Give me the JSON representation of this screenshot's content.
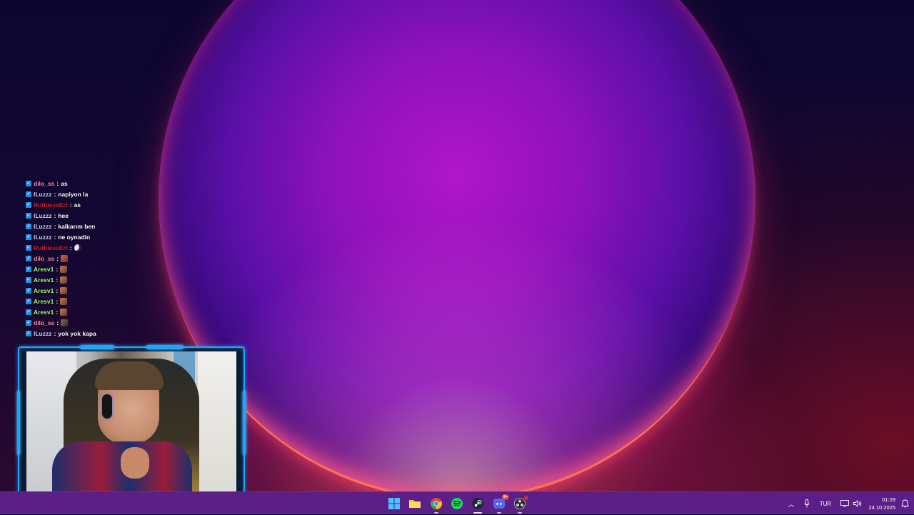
{
  "chat": {
    "messages": [
      {
        "user": "dilo_ss",
        "user_color": "#ff8fb0",
        "text": "as",
        "emote": null
      },
      {
        "user": "lLuzzz",
        "user_color": "#c9d6ff",
        "text": "napiyon la",
        "emote": null
      },
      {
        "user": "RuthlessErt",
        "user_color": "#d4202a",
        "text": "as",
        "emote": null
      },
      {
        "user": "lLuzzz",
        "user_color": "#c9d6ff",
        "text": "hee",
        "emote": null
      },
      {
        "user": "lLuzzz",
        "user_color": "#c9d6ff",
        "text": "kalkarım ben",
        "emote": null
      },
      {
        "user": "lLuzzz",
        "user_color": "#c9d6ff",
        "text": "ne oynadin",
        "emote": null
      },
      {
        "user": "RuthlessErt",
        "user_color": "#d4202a",
        "text": "",
        "emote": "moon"
      },
      {
        "user": "dilo_ss",
        "user_color": "#ff8fb0",
        "text": "",
        "emote": "face"
      },
      {
        "user": "Aresv1",
        "user_color": "#9cff7a",
        "text": "",
        "emote": "cat"
      },
      {
        "user": "Aresv1",
        "user_color": "#9cff7a",
        "text": "",
        "emote": "cat"
      },
      {
        "user": "Aresv1",
        "user_color": "#9cff7a",
        "text": "",
        "emote": "cat"
      },
      {
        "user": "Aresv1",
        "user_color": "#9cff7a",
        "text": "",
        "emote": "cat"
      },
      {
        "user": "Aresv1",
        "user_color": "#9cff7a",
        "text": "",
        "emote": "cat"
      },
      {
        "user": "dilo_ss",
        "user_color": "#ff8fb0",
        "text": "",
        "emote": "group"
      },
      {
        "user": "lLuzzz",
        "user_color": "#c9d6ff",
        "text": "yok yok kapa",
        "emote": null
      }
    ],
    "separator": ":"
  },
  "taskbar": {
    "apps": [
      {
        "name": "windows-start",
        "icon": "windows-logo-icon"
      },
      {
        "name": "file-explorer",
        "icon": "folder-icon"
      },
      {
        "name": "chrome",
        "icon": "chrome-icon"
      },
      {
        "name": "spotify",
        "icon": "spotify-icon"
      },
      {
        "name": "steam",
        "icon": "steam-icon"
      },
      {
        "name": "discord",
        "icon": "discord-icon",
        "badge": "9+"
      },
      {
        "name": "obs",
        "icon": "obs-icon"
      }
    ],
    "tray": {
      "language": "TUR",
      "time": "01:28",
      "date": "24.10.2025"
    }
  },
  "colors": {
    "taskbar": "#5c1f88",
    "cam_frame": "#1ea6ff",
    "chat_badge": "#1f8fe6"
  }
}
